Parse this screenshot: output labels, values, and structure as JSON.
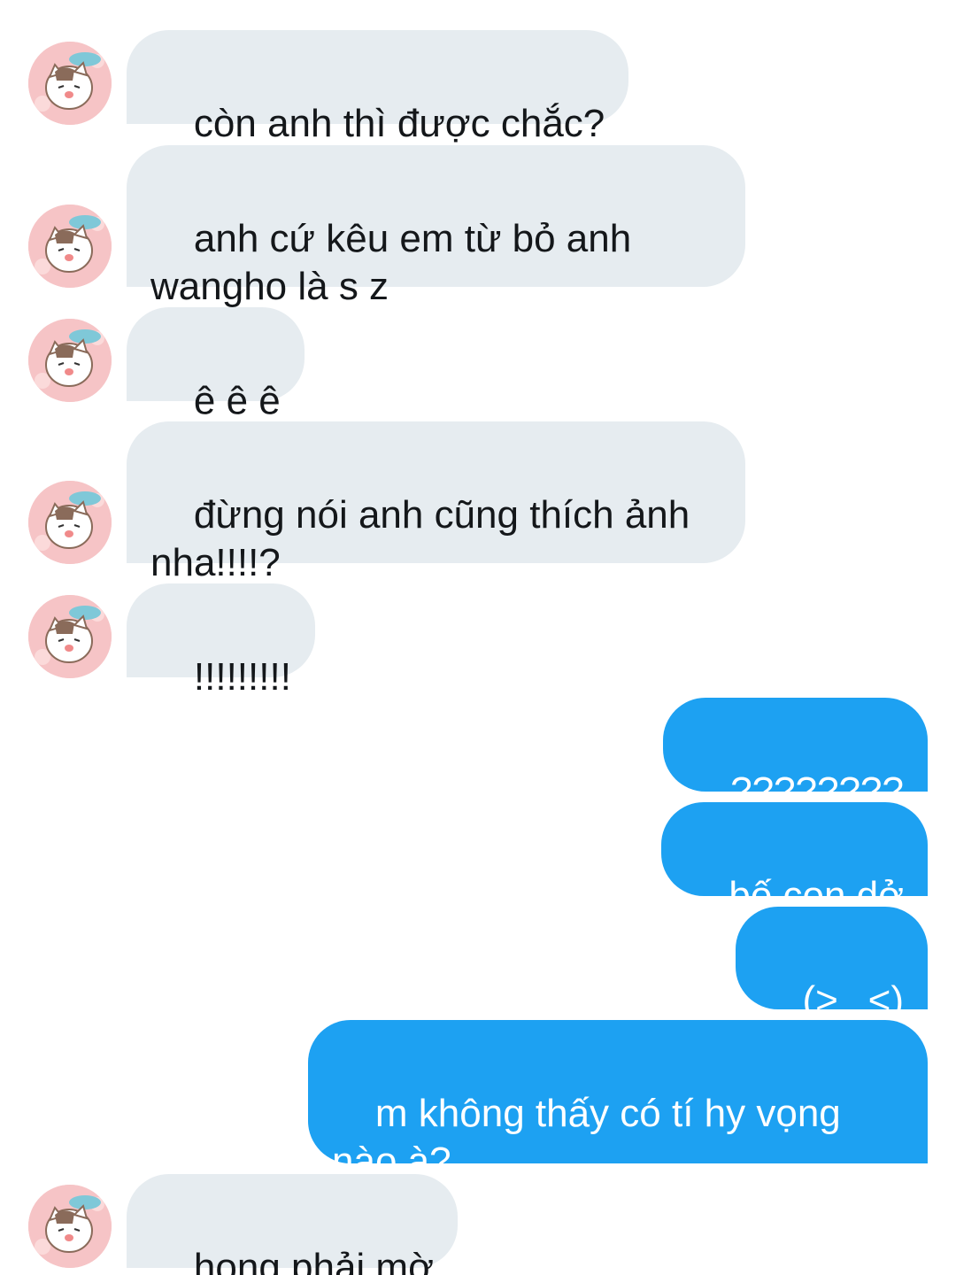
{
  "conversation": {
    "messages": [
      {
        "direction": "received",
        "text": "còn anh thì được chắc?"
      },
      {
        "direction": "received",
        "text": "anh cứ kêu em từ bỏ anh wangho là s z"
      },
      {
        "direction": "received",
        "text": "ê ê ê"
      },
      {
        "direction": "received",
        "text": "đừng nói anh cũng thích ảnh nha!!!!?"
      },
      {
        "direction": "received",
        "text": "!!!!!!!!!"
      },
      {
        "direction": "sent",
        "text": "????????"
      },
      {
        "direction": "sent",
        "text": "bố con dở"
      },
      {
        "direction": "sent",
        "text": "(>▂<)"
      },
      {
        "direction": "sent",
        "text": "m không thấy có tí hy vọng nào à?"
      },
      {
        "direction": "received",
        "text": "hong phải mờ"
      }
    ]
  },
  "colors": {
    "received_bubble": "#e6ecf0",
    "sent_bubble": "#1da1f2",
    "received_text": "#14171a",
    "sent_text": "#ffffff"
  },
  "icons": {
    "avatar": "cat-avatar-icon"
  }
}
